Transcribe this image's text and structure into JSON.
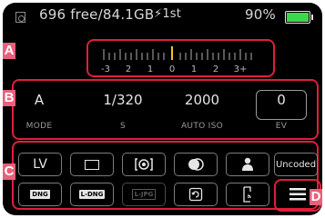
{
  "status": {
    "storage": "696 free/84.1GB",
    "flash": "⚡1st",
    "battery": "90%",
    "battery_color": "#3dd84a"
  },
  "regions": {
    "a": "A",
    "b": "B",
    "c": "C",
    "d": "D"
  },
  "scale": [
    "-3",
    "2",
    "1",
    "0",
    "1",
    "2",
    "3+"
  ],
  "params": [
    {
      "value": "A",
      "label": "MODE"
    },
    {
      "value": "1/320",
      "label": "S"
    },
    {
      "value": "2000",
      "label": "AUTO ISO"
    },
    {
      "value": "0",
      "label": "EV"
    }
  ],
  "buttons": {
    "lv": "LV",
    "uncoded": "Uncoded",
    "dng": "DNG",
    "l_dng": "L-DNG",
    "l_jpg": "L-JPG"
  },
  "icons": [
    "memory-card-icon",
    "frame-icon",
    "metering-icon",
    "color-style-icon",
    "user-icon",
    "stabilization-icon",
    "phone-icon",
    "menu-icon"
  ],
  "colors": {
    "callout": "#e01e3c",
    "marker": "#f2c618"
  }
}
